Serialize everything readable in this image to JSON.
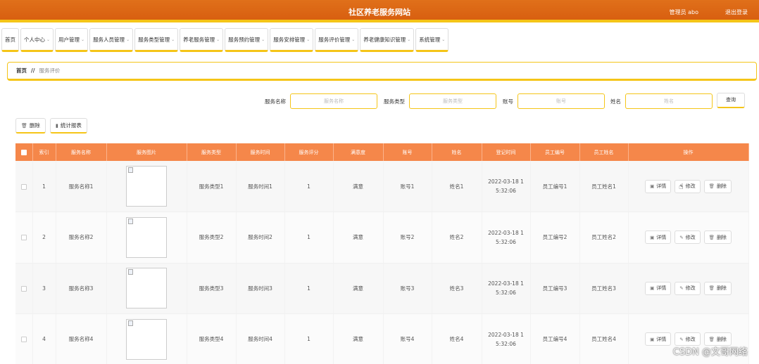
{
  "header": {
    "title": "社区养老服务网站",
    "admin": "管理员 abo",
    "logout": "退出登录"
  },
  "nav": {
    "items": [
      {
        "label": "首页",
        "chevron": ""
      },
      {
        "label": "个人中心",
        "chevron": "⌄"
      },
      {
        "label": "用户管理",
        "chevron": "⌄"
      },
      {
        "label": "服务人员管理",
        "chevron": "⌄"
      },
      {
        "label": "服务类型管理",
        "chevron": "⌄"
      },
      {
        "label": "养老服务管理",
        "chevron": "⌄"
      },
      {
        "label": "服务预约管理",
        "chevron": "⌄"
      },
      {
        "label": "服务安排管理",
        "chevron": "⌄"
      },
      {
        "label": "服务评价管理",
        "chevron": "⌄"
      },
      {
        "label": "养老健康知识管理",
        "chevron": "⌄"
      },
      {
        "label": "系统管理",
        "chevron": "⌄"
      }
    ]
  },
  "breadcrumb": {
    "home": "首页",
    "separator": "//",
    "current": "服务评价"
  },
  "search": {
    "service_name_label": "服务名称",
    "service_name_placeholder": "服务名称",
    "service_type_label": "服务类型",
    "service_type_placeholder": "服务类型",
    "account_label": "账号",
    "account_placeholder": "账号",
    "name_label": "姓名",
    "name_placeholder": "姓名",
    "query_button": "查询"
  },
  "actions": {
    "delete_label": "删除",
    "delete_icon": "trash-icon",
    "report_label": "统计报表",
    "report_icon": "bar-chart-icon"
  },
  "table": {
    "columns": [
      "",
      "索引",
      "服务名称",
      "服务图片",
      "服务类型",
      "服务时间",
      "服务评分",
      "满意度",
      "账号",
      "姓名",
      "登记时间",
      "员工编号",
      "员工姓名",
      "操作"
    ],
    "rows": [
      {
        "index": "1",
        "service_name": "服务名称1",
        "service_type": "服务类型1",
        "service_time": "服务时间1",
        "score": "1",
        "satisfaction": "满意",
        "account": "账号1",
        "name": "姓名1",
        "reg_date": "2022-03-18 1",
        "reg_time": "5:32:06",
        "staff_no": "员工编号1",
        "staff_name": "员工姓名1"
      },
      {
        "index": "2",
        "service_name": "服务名称2",
        "service_type": "服务类型2",
        "service_time": "服务时间2",
        "score": "1",
        "satisfaction": "满意",
        "account": "账号2",
        "name": "姓名2",
        "reg_date": "2022-03-18 1",
        "reg_time": "5:32:06",
        "staff_no": "员工编号2",
        "staff_name": "员工姓名2"
      },
      {
        "index": "3",
        "service_name": "服务名称3",
        "service_type": "服务类型3",
        "service_time": "服务时间3",
        "score": "1",
        "satisfaction": "满意",
        "account": "账号3",
        "name": "姓名3",
        "reg_date": "2022-03-18 1",
        "reg_time": "5:32:06",
        "staff_no": "员工编号3",
        "staff_name": "员工姓名3"
      },
      {
        "index": "4",
        "service_name": "服务名称4",
        "service_type": "服务类型4",
        "service_time": "服务时间4",
        "score": "1",
        "satisfaction": "满意",
        "account": "账号4",
        "name": "姓名4",
        "reg_date": "2022-03-18 1",
        "reg_time": "5:32:06",
        "staff_no": "员工编号4",
        "staff_name": "员工姓名4"
      }
    ],
    "row_actions": {
      "detail": "详情",
      "edit": "修改",
      "delete": "删除"
    }
  },
  "watermark": "CSDN @文哥网络",
  "colors": {
    "header": "#d85f10",
    "accent": "#f5c518",
    "table_header": "#f5874a"
  }
}
